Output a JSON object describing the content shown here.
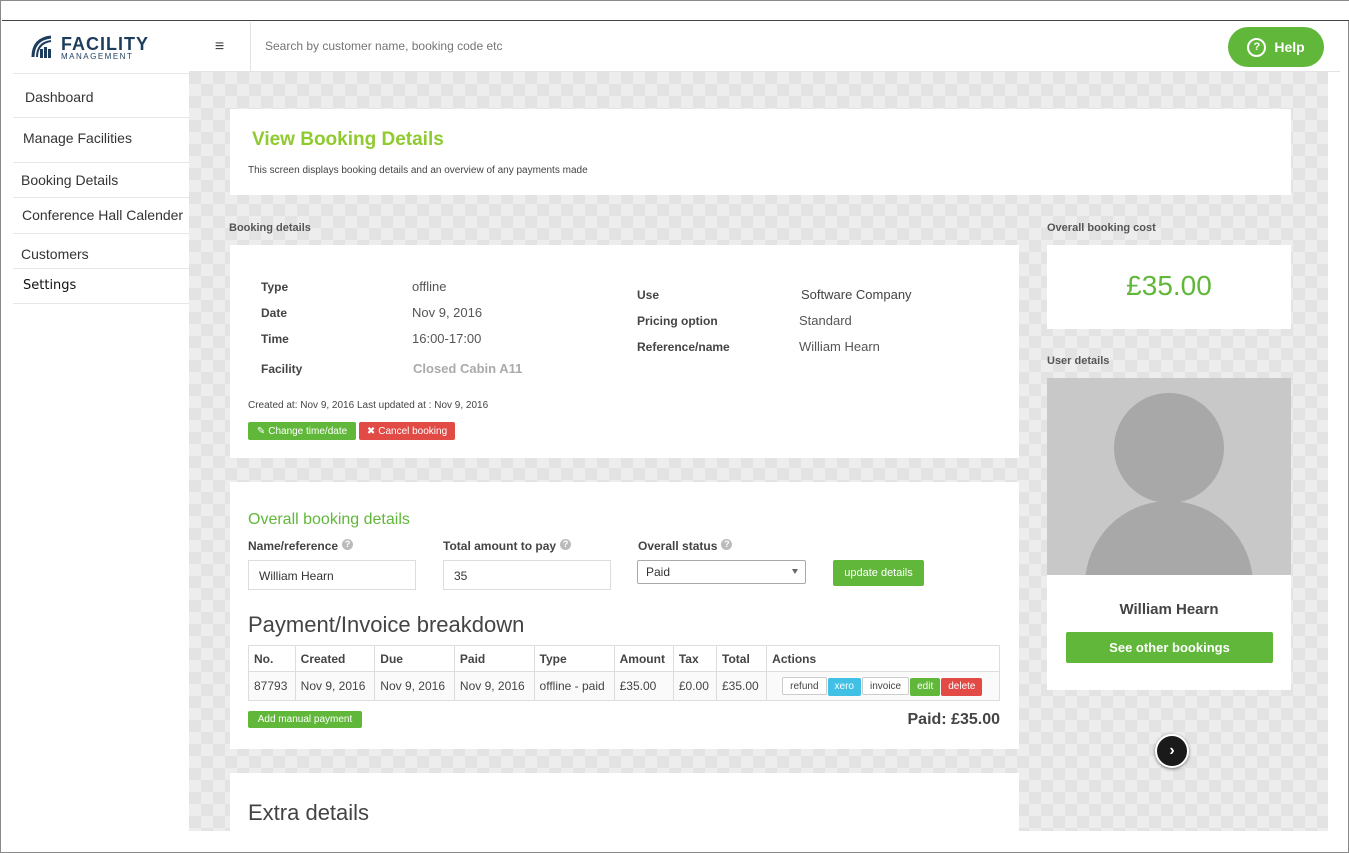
{
  "logo": {
    "line1": "FACILITY",
    "line2": "MANAGEMENT"
  },
  "sidebar": {
    "items": [
      {
        "label": "Dashboard"
      },
      {
        "label": "Manage Facilities"
      },
      {
        "label": "Booking Details"
      },
      {
        "label": "Conference Hall Calender"
      },
      {
        "label": "Customers"
      },
      {
        "label": "Settings"
      }
    ]
  },
  "header": {
    "menu_icon": "≡",
    "search_placeholder": "Search by customer name, booking code etc",
    "help_label": "Help"
  },
  "page": {
    "title": "View Booking Details",
    "subtitle": "This screen displays booking details and an overview of any payments made"
  },
  "booking": {
    "section_label": "Booking details",
    "type_label": "Type",
    "type_value": "offline",
    "date_label": "Date",
    "date_value": "Nov 9, 2016",
    "time_label": "Time",
    "time_value": "16:00-17:00",
    "facility_label": "Facility",
    "facility_value": "Closed Cabin A11",
    "use_label": "Use",
    "use_value": "Software Company",
    "pricing_label": "Pricing option",
    "pricing_value": "Standard",
    "reference_label": "Reference/name",
    "reference_value": "William Hearn",
    "created_text": "Created at: Nov 9, 2016 Last updated at : Nov 9, 2016",
    "change_btn": "Change time/date",
    "cancel_btn": "Cancel booking"
  },
  "overall": {
    "heading": "Overall booking details",
    "name_label": "Name/reference",
    "name_value": "William Hearn",
    "amount_label": "Total amount to pay",
    "amount_value": "35",
    "status_label": "Overall status",
    "status_value": "Paid",
    "update_btn": "update details"
  },
  "payments": {
    "heading": "Payment/Invoice breakdown",
    "columns": [
      "No.",
      "Created",
      "Due",
      "Paid",
      "Type",
      "Amount",
      "Tax",
      "Total",
      "Actions"
    ],
    "rows": [
      {
        "no": "87793",
        "created": "Nov 9, 2016",
        "due": "Nov 9, 2016",
        "paid": "Nov 9, 2016",
        "type": "offline - paid",
        "amount": "£35.00",
        "tax": "£0.00",
        "total": "£35.00"
      }
    ],
    "actions": {
      "refund": "refund",
      "xero": "xero",
      "invoice": "invoice",
      "edit": "edit",
      "delete": "delete"
    },
    "add_btn": "Add manual payment",
    "paid_total": "Paid: £35.00"
  },
  "extra": {
    "heading": "Extra details"
  },
  "cost": {
    "label": "Overall booking cost",
    "value": "£35.00"
  },
  "user": {
    "label": "User details",
    "name": "William Hearn",
    "bookings_btn": "See other bookings"
  },
  "colors": {
    "accent_green": "#61b73a",
    "title_green": "#8fca2f",
    "danger_red": "#e24a45",
    "xero_blue": "#40c0e5"
  }
}
